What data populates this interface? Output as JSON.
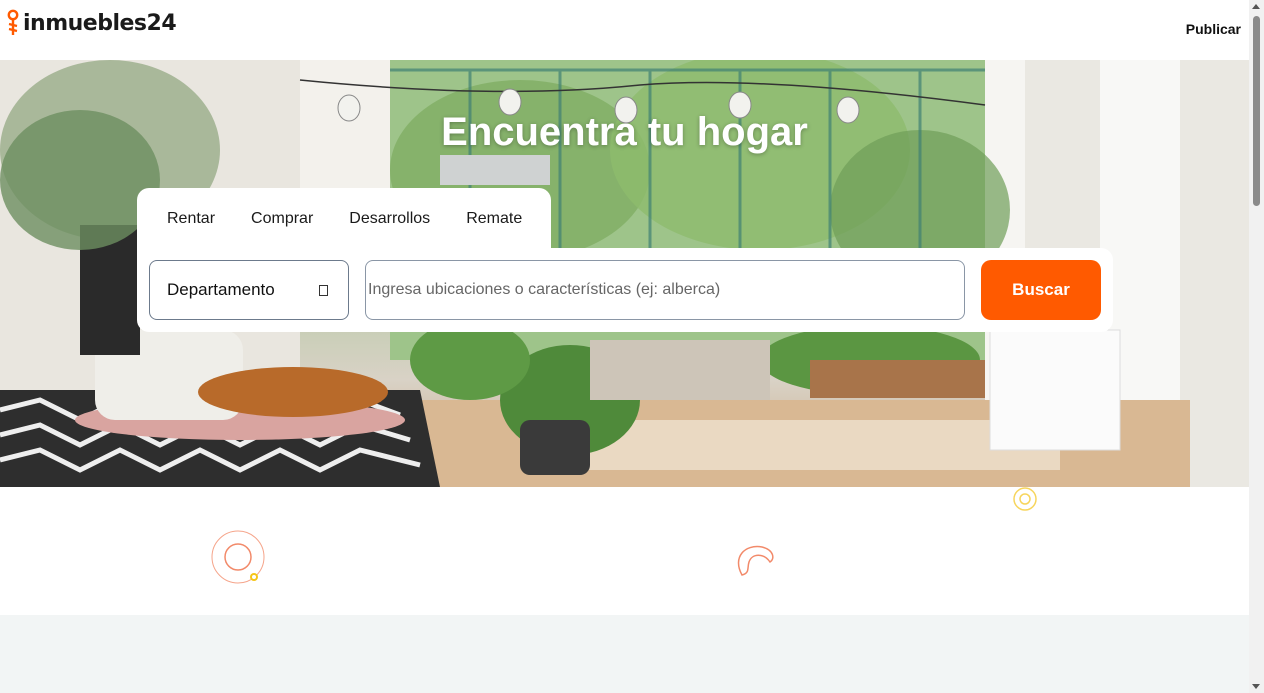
{
  "header": {
    "logo_text": "inmuebles24",
    "publish_label": "Publicar"
  },
  "hero": {
    "title": "Encuentra tu hogar"
  },
  "search": {
    "tabs": [
      {
        "label": "Rentar"
      },
      {
        "label": "Comprar"
      },
      {
        "label": "Desarrollos"
      },
      {
        "label": "Remate"
      }
    ],
    "property_type": "Departamento",
    "placeholder": "Ingresa ubicaciones o características (ej: alberca)",
    "button_label": "Buscar"
  },
  "colors": {
    "brand": "#ff5a00",
    "decor_yellow": "#f5c518"
  },
  "icons": {
    "logo": "key-icon",
    "select": "chevron-down-icon"
  }
}
